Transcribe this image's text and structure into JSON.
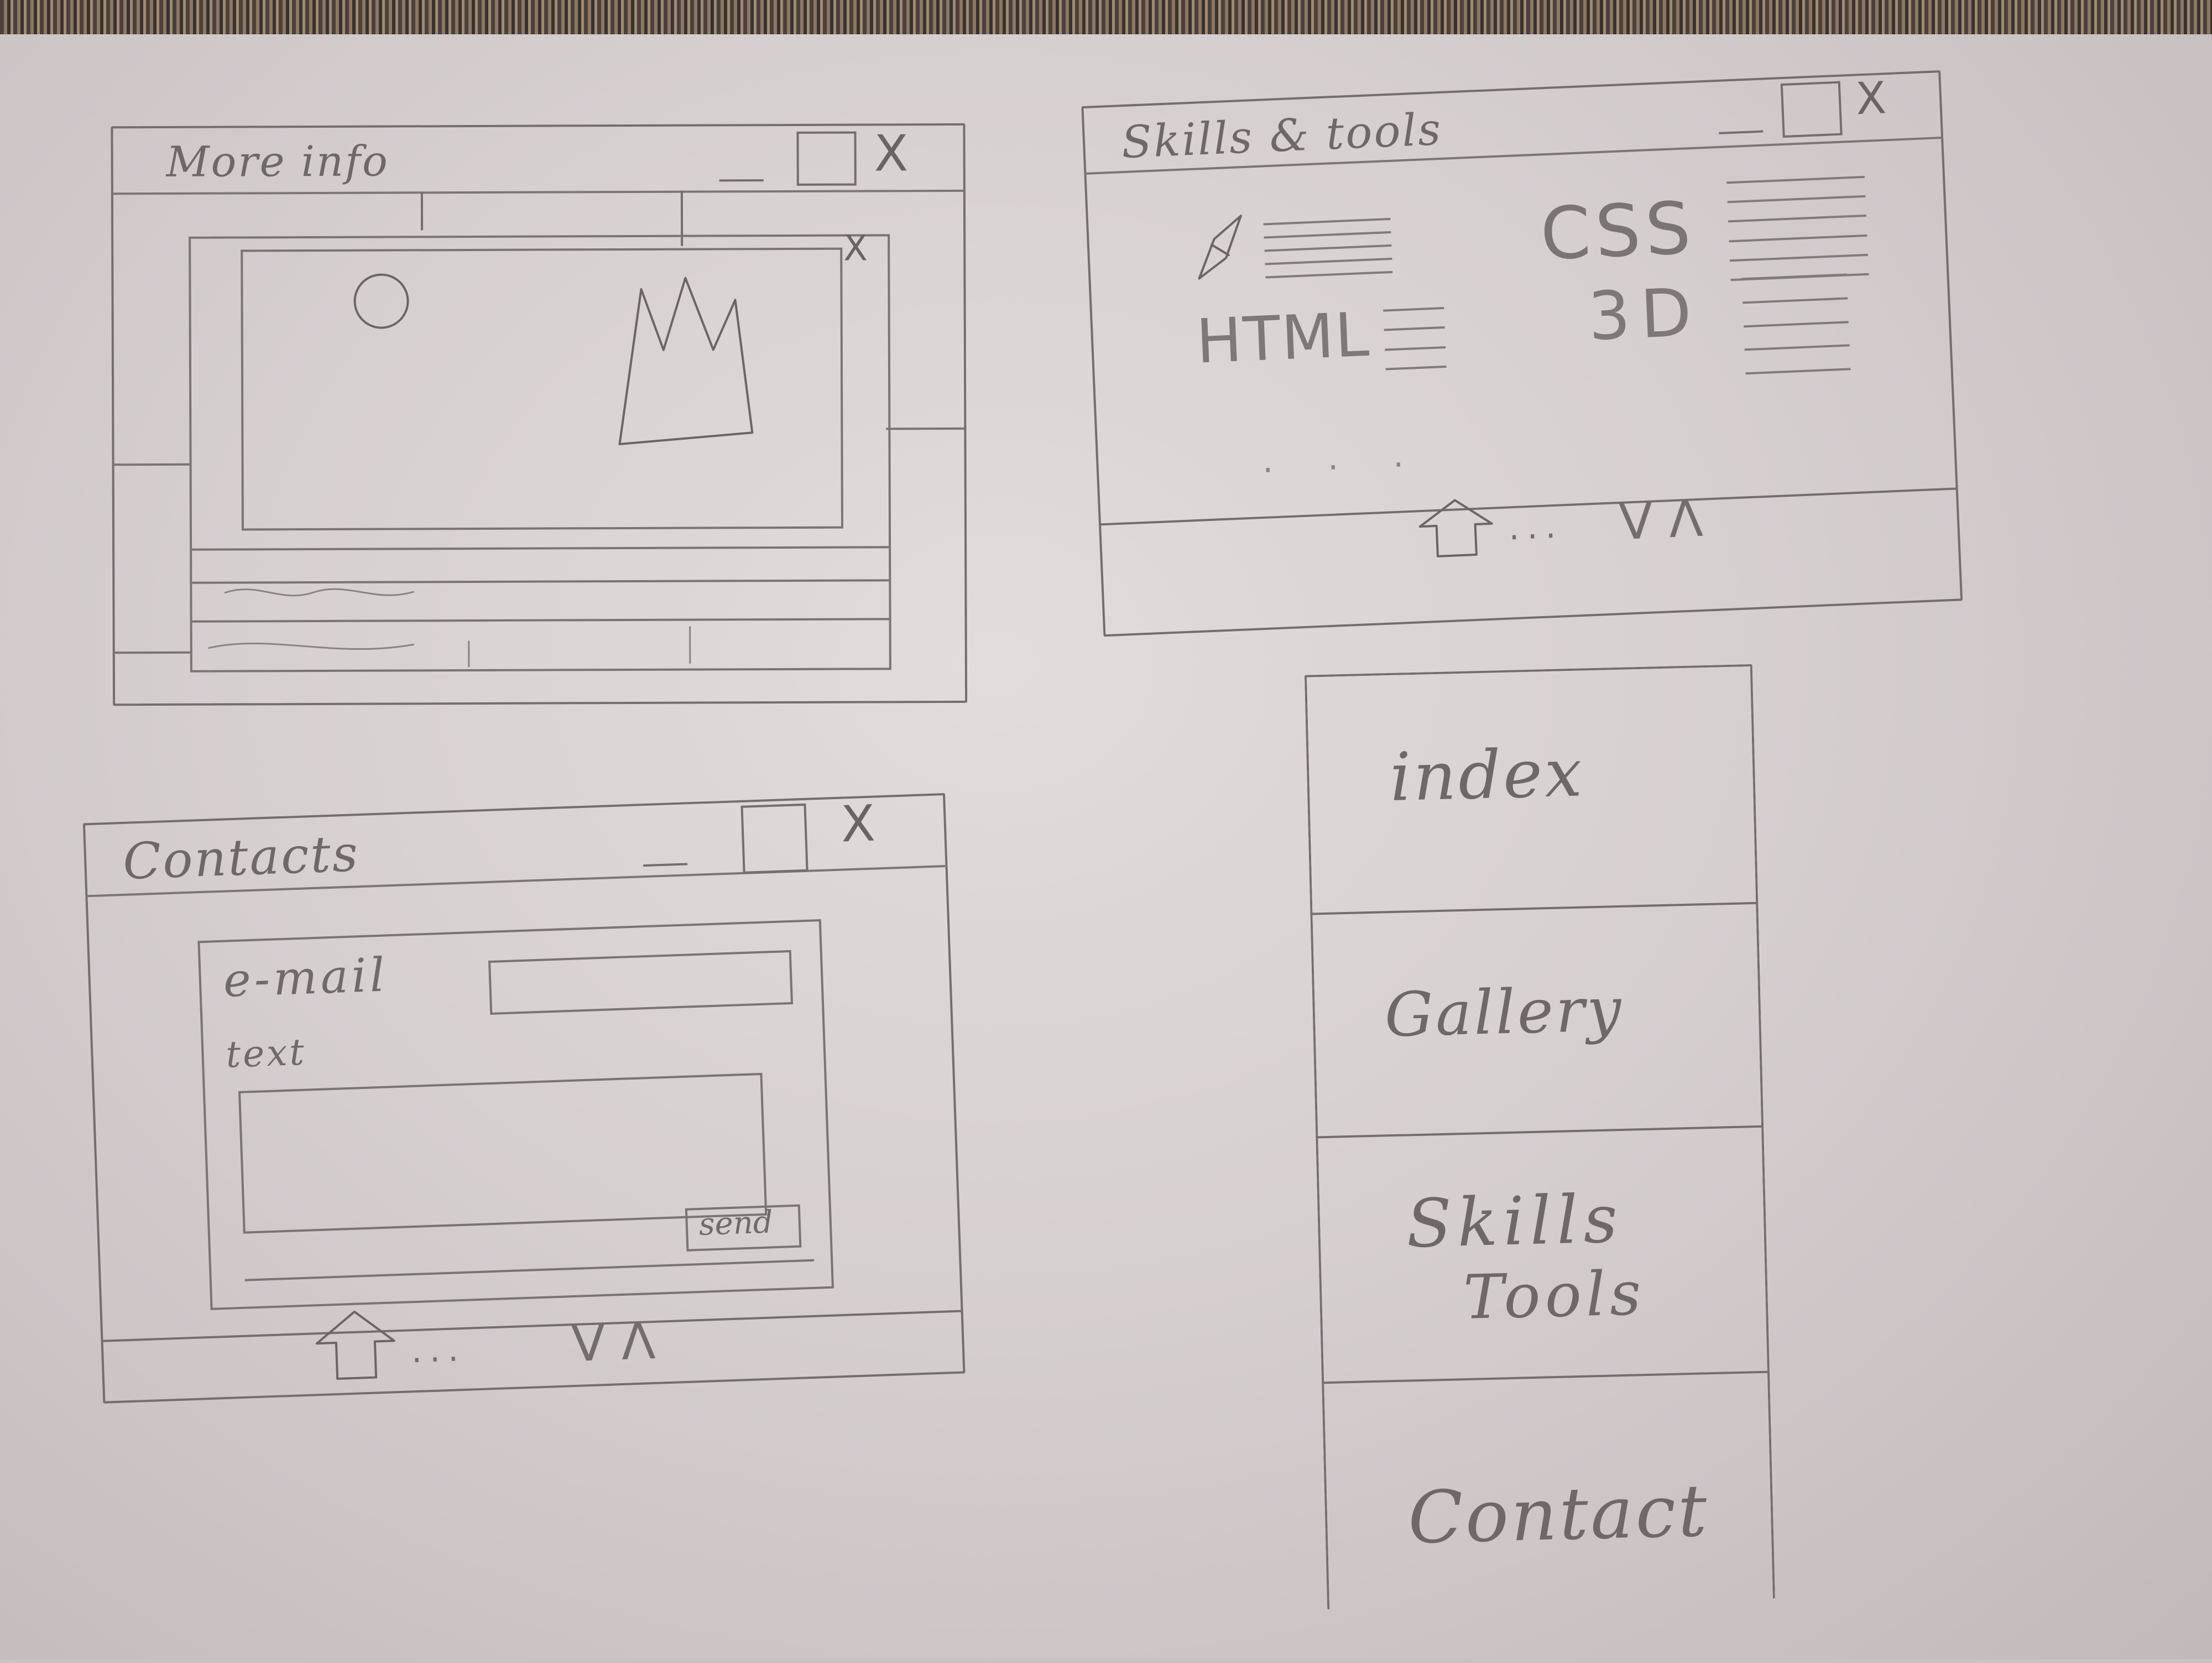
{
  "windows": {
    "more_info": {
      "title": "More info",
      "controls": {
        "minimize": "_",
        "maximize": "□",
        "close": "X"
      },
      "image_close": "X"
    },
    "skills": {
      "title": "Skills & tools",
      "controls": {
        "minimize": "_",
        "maximize": "□",
        "close": "X"
      },
      "items": [
        "CSS",
        "HTML",
        "3D"
      ],
      "footer": {
        "ellipsis": "...",
        "nav": "V Λ"
      }
    },
    "contacts": {
      "title": "Contacts",
      "controls": {
        "minimize": "_",
        "maximize": "□",
        "close": "X"
      },
      "email_label": "e-mail",
      "text_label": "text",
      "send_label": "send",
      "footer": {
        "ellipsis": "...",
        "nav": "V Λ"
      }
    }
  },
  "menu": {
    "items": [
      {
        "label": "index"
      },
      {
        "label": "Gallery"
      },
      {
        "label": "Skills & tools",
        "label_line1": "Skills",
        "label_line2": "Tools"
      },
      {
        "label": "Contact"
      }
    ]
  }
}
